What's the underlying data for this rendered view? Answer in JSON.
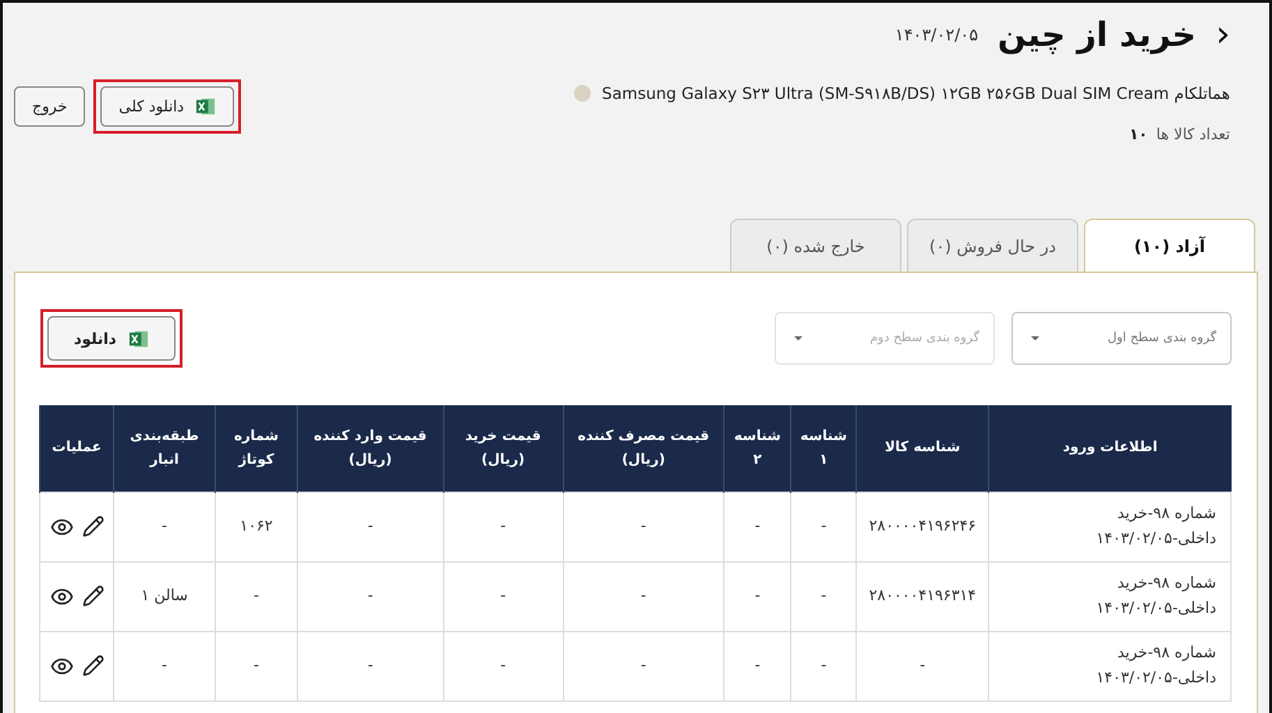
{
  "header": {
    "back": "‹",
    "title": "خرید از چین",
    "date": "۱۴۰۳/۰۲/۰۵"
  },
  "actions": [
    {
      "kind": "excel",
      "label": "دانلود کلی",
      "highlighted": true
    },
    {
      "kind": "plain",
      "label": "خروج",
      "highlighted": false
    }
  ],
  "product": {
    "name": "هماتلکام Samsung Galaxy S۲۳ Ultra (SM-S۹۱۸B/DS) ۱۲GB ۲۵۶GB Dual SIM Cream",
    "color": "#d9d3c3"
  },
  "count": {
    "label": "تعداد کالا ها",
    "value": "۱۰"
  },
  "tabs": [
    {
      "label": "آزاد (۱۰)",
      "selected": true
    },
    {
      "label": "در حال فروش (۰)",
      "selected": false
    },
    {
      "label": "خارج شده (۰)",
      "selected": false
    }
  ],
  "filters": [
    {
      "placeholder": "گروه بندی سطح اول",
      "disabled": false
    },
    {
      "placeholder": "گروه بندی سطح دوم",
      "disabled": true
    }
  ],
  "download": {
    "label": "دانلود",
    "highlighted": true
  },
  "table": {
    "columns": [
      "اطلاعات ورود",
      "شناسه کالا",
      "شناسه ۱",
      "شناسه ۲",
      "قیمت مصرف کننده (ریال)",
      "قیمت خرید (ریال)",
      "قیمت وارد کننده (ریال)",
      "شماره کوتاژ",
      "طبقه‌بندی انبار",
      "عملیات"
    ],
    "rows": [
      {
        "cells": [
          "شماره ۹۸-خرید داخلی-۱۴۰۳/۰۲/۰۵",
          "۲۸۰۰۰۰۴۱۹۶۲۴۶",
          "-",
          "-",
          "-",
          "-",
          "-",
          "۱۰۶۲",
          "-"
        ]
      },
      {
        "cells": [
          "شماره ۹۸-خرید داخلی-۱۴۰۳/۰۲/۰۵",
          "۲۸۰۰۰۰۴۱۹۶۳۱۴",
          "-",
          "-",
          "-",
          "-",
          "-",
          "-",
          "سالن ۱"
        ]
      },
      {
        "cells": [
          "شماره ۹۸-خرید داخلی-۱۴۰۳/۰۲/۰۵",
          "-",
          "-",
          "-",
          "-",
          "-",
          "-",
          "-",
          "-"
        ]
      }
    ]
  }
}
